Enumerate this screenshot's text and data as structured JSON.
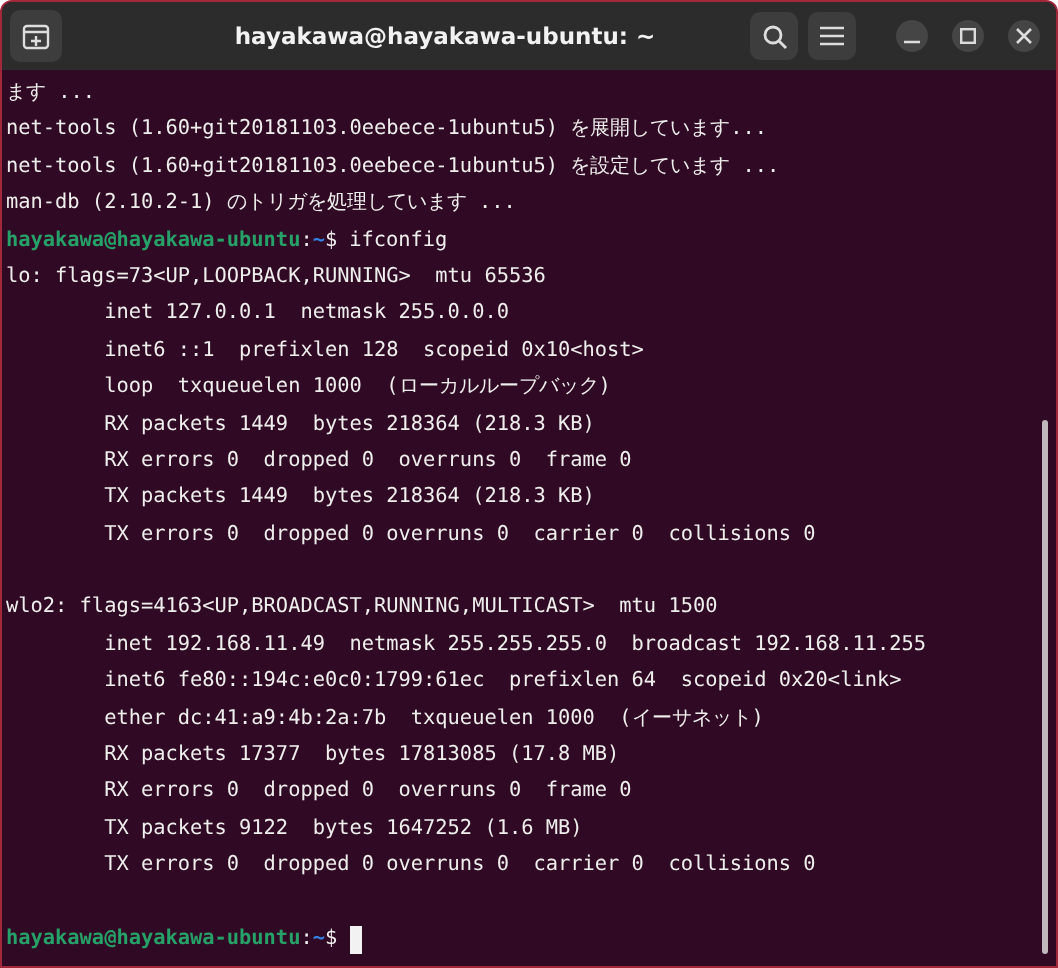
{
  "window": {
    "title": "hayakawa@hayakawa-ubuntu: ~"
  },
  "terminal": {
    "lines": [
      {
        "kind": "output",
        "text": "ます ..."
      },
      {
        "kind": "output",
        "text": "net-tools (1.60+git20181103.0eebece-1ubuntu5) を展開しています..."
      },
      {
        "kind": "output",
        "text": "net-tools (1.60+git20181103.0eebece-1ubuntu5) を設定しています ..."
      },
      {
        "kind": "output",
        "text": "man-db (2.10.2-1) のトリガを処理しています ..."
      },
      {
        "kind": "prompt",
        "user": "hayakawa@hayakawa-ubuntu",
        "separator": ":",
        "path": "~",
        "symbol": "$",
        "command": "ifconfig",
        "cursor": false
      },
      {
        "kind": "output",
        "text": "lo: flags=73<UP,LOOPBACK,RUNNING>  mtu 65536"
      },
      {
        "kind": "output",
        "text": "        inet 127.0.0.1  netmask 255.0.0.0"
      },
      {
        "kind": "output",
        "text": "        inet6 ::1  prefixlen 128  scopeid 0x10<host>"
      },
      {
        "kind": "output",
        "text": "        loop  txqueuelen 1000  (ローカルループバック)"
      },
      {
        "kind": "output",
        "text": "        RX packets 1449  bytes 218364 (218.3 KB)"
      },
      {
        "kind": "output",
        "text": "        RX errors 0  dropped 0  overruns 0  frame 0"
      },
      {
        "kind": "output",
        "text": "        TX packets 1449  bytes 218364 (218.3 KB)"
      },
      {
        "kind": "output",
        "text": "        TX errors 0  dropped 0 overruns 0  carrier 0  collisions 0"
      },
      {
        "kind": "blank"
      },
      {
        "kind": "output",
        "text": "wlo2: flags=4163<UP,BROADCAST,RUNNING,MULTICAST>  mtu 1500"
      },
      {
        "kind": "output",
        "text": "        inet 192.168.11.49  netmask 255.255.255.0  broadcast 192.168.11.255"
      },
      {
        "kind": "output",
        "text": "        inet6 fe80::194c:e0c0:1799:61ec  prefixlen 64  scopeid 0x20<link>"
      },
      {
        "kind": "output",
        "text": "        ether dc:41:a9:4b:2a:7b  txqueuelen 1000  (イーサネット)"
      },
      {
        "kind": "output",
        "text": "        RX packets 17377  bytes 17813085 (17.8 MB)"
      },
      {
        "kind": "output",
        "text": "        RX errors 0  dropped 0  overruns 0  frame 0"
      },
      {
        "kind": "output",
        "text": "        TX packets 9122  bytes 1647252 (1.6 MB)"
      },
      {
        "kind": "output",
        "text": "        TX errors 0  dropped 0 overruns 0  carrier 0  collisions 0"
      },
      {
        "kind": "blank"
      },
      {
        "kind": "prompt",
        "user": "hayakawa@hayakawa-ubuntu",
        "separator": ":",
        "path": "~",
        "symbol": "$",
        "cursor": true
      }
    ]
  }
}
